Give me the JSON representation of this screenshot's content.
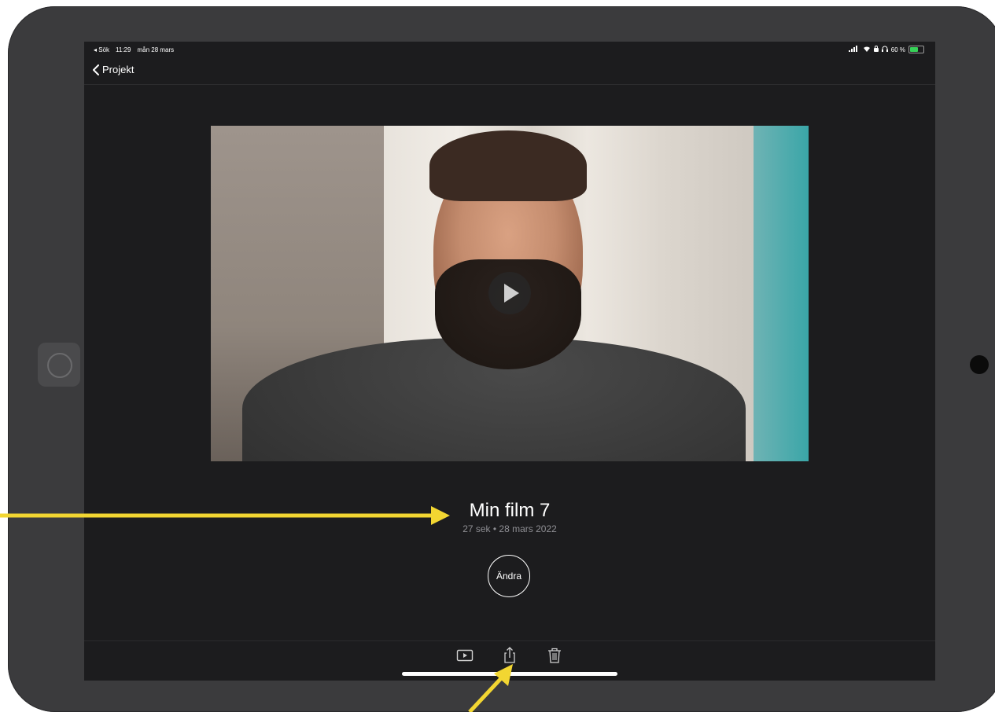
{
  "status_bar": {
    "back_app": "◂ Sök",
    "time": "11:29",
    "date": "mån 28 mars",
    "battery_percent": "60 %",
    "icons": [
      "signal-icon",
      "wifi-icon",
      "lock-rotation-icon",
      "headphones-icon",
      "battery-charging-icon"
    ]
  },
  "nav": {
    "back_label": "Projekt"
  },
  "project": {
    "title": "Min film 7",
    "meta": "27 sek • 28 mars 2022",
    "edit_label": "Ändra"
  },
  "toolbar": {
    "icons": [
      "play-preview-icon",
      "share-icon",
      "trash-icon"
    ]
  },
  "colors": {
    "screen_bg": "#1c1c1e",
    "device_frame": "#3b3b3d",
    "annotation_arrow": "#f2d632",
    "secondary_text": "#8e8e93"
  }
}
